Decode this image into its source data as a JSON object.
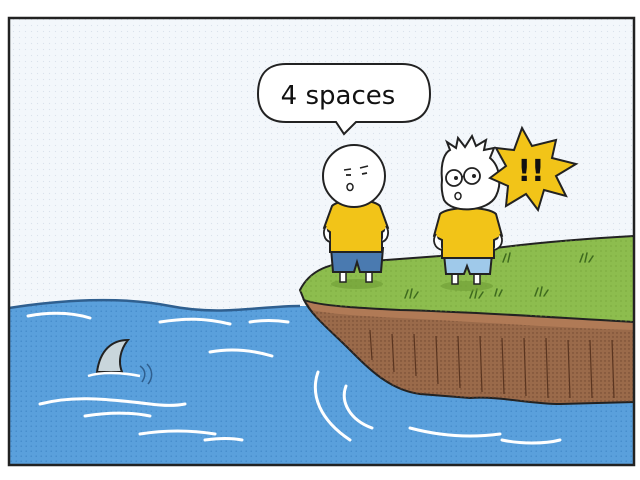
{
  "speech_bubble": {
    "text": "4 spaces"
  },
  "exclamation": {
    "text": "!!"
  },
  "colors": {
    "sky": "#f3f7fb",
    "water": "#5aa0dc",
    "grass": "#8dbd4e",
    "dirt": "#9a6a4a",
    "shirt": "#f2c418",
    "shorts_left": "#4a7ab0",
    "shorts_right": "#9fc9ea",
    "shark_fin": "#c9d6dc",
    "burst": "#f2c418"
  }
}
